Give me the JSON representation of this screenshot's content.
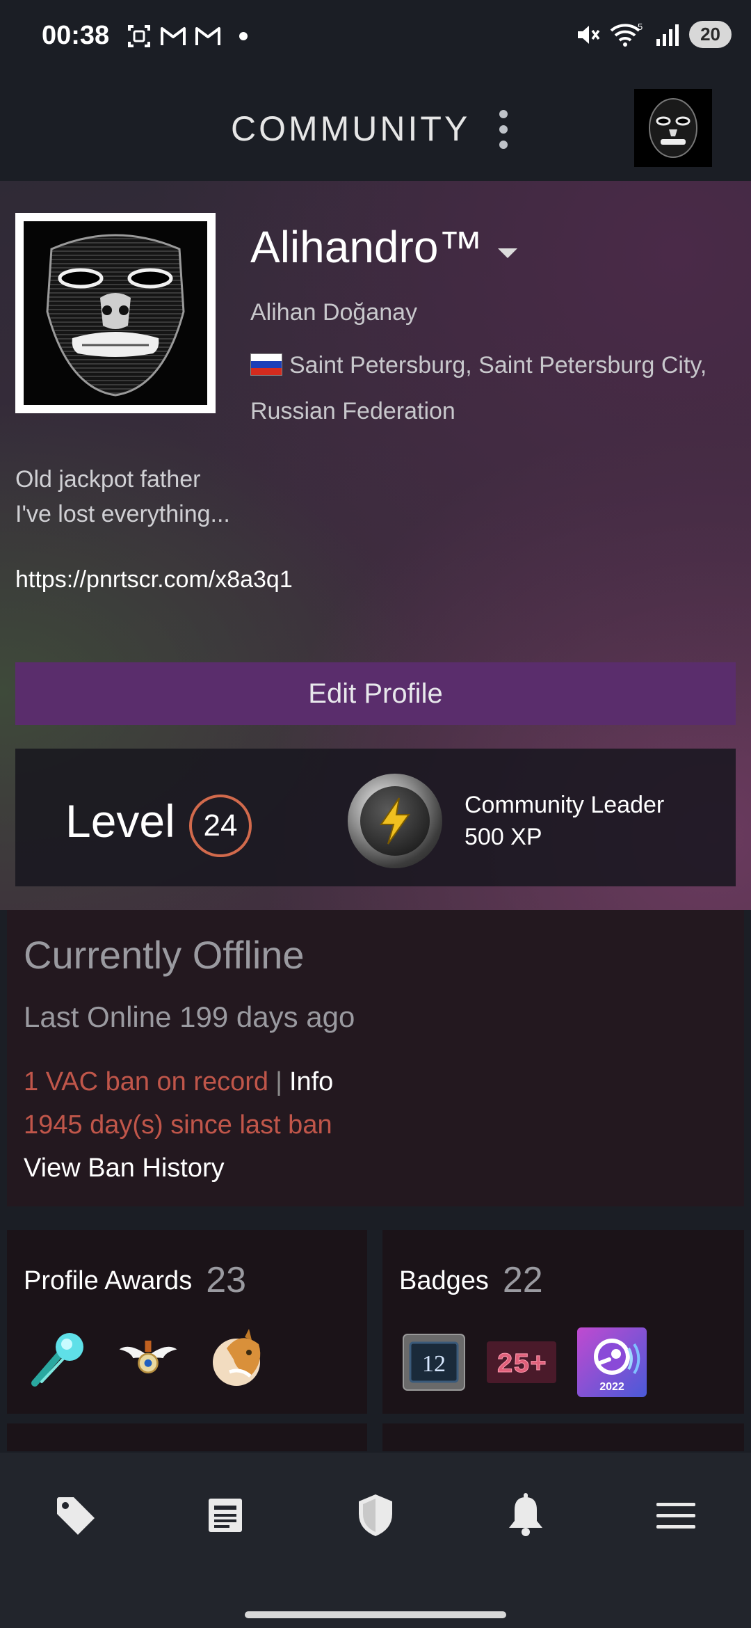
{
  "status_bar": {
    "time": "00:38",
    "notification_icons": [
      "screenshot-icon",
      "gmail-icon",
      "gmail-icon"
    ],
    "signal_label": "5",
    "battery": "20"
  },
  "header": {
    "title": "COMMUNITY"
  },
  "profile": {
    "persona_name": "Alihandro™",
    "real_name": "Alihan Doğanay",
    "location": "Saint Petersburg, Saint Petersburg City, Russian Federation",
    "summary_line1": "Old jackpot father",
    "summary_line2": "I've lost everything...",
    "link": "https://pnrtscr.com/x8a3q1",
    "edit_button": "Edit Profile"
  },
  "level": {
    "label": "Level",
    "value": "24",
    "badge_title": "Community Leader",
    "badge_xp": "500 XP"
  },
  "status": {
    "title": "Currently Offline",
    "last_online": "Last Online 199 days ago",
    "vac": "1 VAC ban on record",
    "separator": "|",
    "info_link": "Info",
    "days_since_ban": "1945 day(s) since last ban",
    "view_history": "View Ban History"
  },
  "showcases": {
    "awards": {
      "title": "Profile Awards",
      "count": "23"
    },
    "badges": {
      "title": "Badges",
      "count": "22",
      "badge_12": "12",
      "badge_25": "25+",
      "badge_year": "2022"
    }
  },
  "bottom_nav": [
    "store-tag-icon",
    "news-icon",
    "guard-shield-icon",
    "notifications-bell-icon",
    "menu-icon"
  ],
  "colors": {
    "accent_purple": "#5a2d6c",
    "level_ring": "#d26a4c",
    "ban_red": "#c0564a"
  }
}
